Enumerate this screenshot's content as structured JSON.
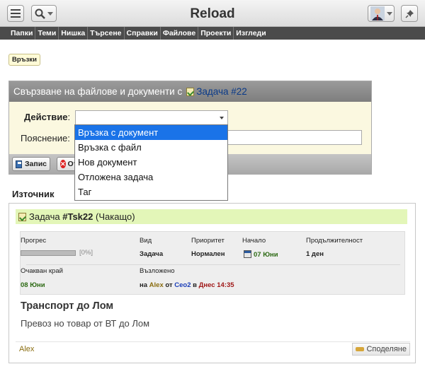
{
  "header": {
    "title": "Reload"
  },
  "nav": [
    "Папки",
    "Теми",
    "Нишка",
    "Търсене",
    "Справки",
    "Файлове",
    "Проекти",
    "Изгледи"
  ],
  "links_button": "Връзки",
  "form": {
    "title": "Свързване на файлове и документи с",
    "task_link": "Задача #22",
    "action_label": "Действие",
    "action_suffix": ":",
    "note_label": "Пояснение:",
    "save_label": "Запис",
    "cancel_label": "Отказ"
  },
  "dropdown": {
    "options": [
      "Връзка с документ",
      "Връзка с файл",
      "Нов документ",
      "Отложена задача",
      "Таг"
    ],
    "highlighted_index": 0
  },
  "source": {
    "title": "Източник",
    "task_prefix": "Задача",
    "task_id": "#Tsk22",
    "task_status": "(Чакащо)",
    "headers": {
      "progress": "Прогрес",
      "type": "Вид",
      "priority": "Приоритет",
      "start": "Начало",
      "duration": "Продължителност",
      "expected_end": "Очакван край",
      "assigned": "Възложено"
    },
    "values": {
      "progress_percent": 0,
      "progress_text": "[0%]",
      "type": "Задача",
      "priority": "Нормален",
      "start": "07 Юни",
      "duration": "1 ден",
      "expected_end": "08 Юни",
      "assigned_on": "на",
      "assigned_to": "Alex",
      "assigned_from_word": "от",
      "assigned_by": "Ceo2",
      "assigned_at_word": "в",
      "assigned_time": "Днес 14:35"
    },
    "task_title": "Транспорт до Лом",
    "task_description": "Превоз но товар от ВТ до Лом",
    "author": "Alex",
    "share_label": "Споделяне"
  }
}
